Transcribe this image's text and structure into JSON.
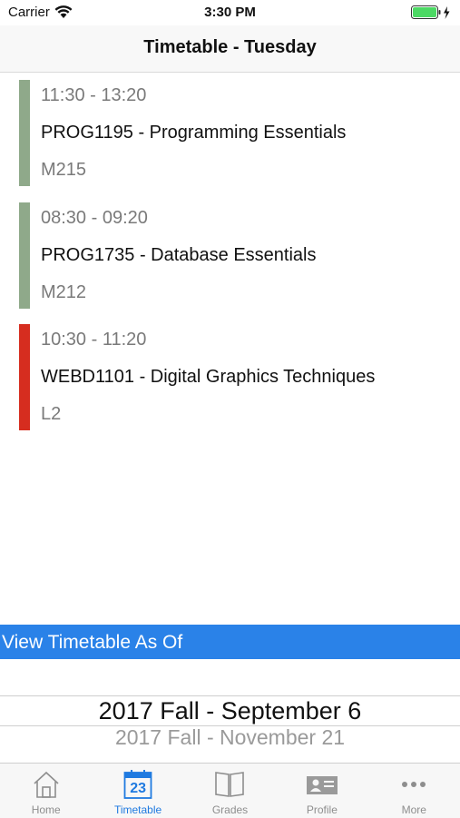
{
  "status_bar": {
    "carrier": "Carrier",
    "time": "3:30 PM"
  },
  "nav": {
    "title": "Timetable - Tuesday"
  },
  "classes": [
    {
      "time": "11:30 - 13:20",
      "name": "PROG1195 - Programming Essentials",
      "room": "M215",
      "color": "#8fa98a"
    },
    {
      "time": "08:30 - 09:20",
      "name": "PROG1735 - Database Essentials",
      "room": "M212",
      "color": "#8fa98a"
    },
    {
      "time": "10:30 - 11:20",
      "name": "WEBD1101 - Digital Graphics Techniques",
      "room": "L2",
      "color": "#d62d1f"
    }
  ],
  "view_timetable": {
    "label": "View Timetable As Of",
    "selected": "2017 Fall - September 6",
    "next": "2017 Fall - November 21"
  },
  "tabs": [
    {
      "label": "Home",
      "icon": "home-icon",
      "active": false
    },
    {
      "label": "Timetable",
      "icon": "calendar-icon",
      "badge": "23",
      "active": true
    },
    {
      "label": "Grades",
      "icon": "book-icon",
      "active": false
    },
    {
      "label": "Profile",
      "icon": "profile-card-icon",
      "active": false
    },
    {
      "label": "More",
      "icon": "more-icon",
      "active": false
    }
  ],
  "colors": {
    "accent": "#1f7ae0",
    "header_blue": "#2a82e8",
    "battery": "#4cd964"
  }
}
